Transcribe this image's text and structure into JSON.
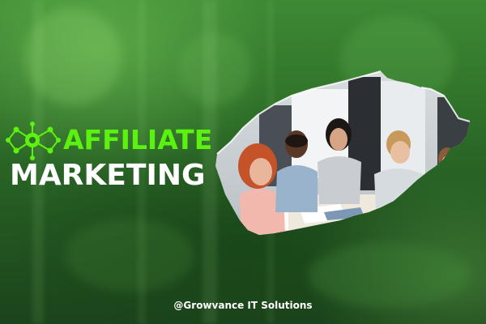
{
  "banner": {
    "title_line1": "AFFILIATE",
    "title_line2": "MARKETING",
    "credit": "@Growvance IT Solutions"
  },
  "logo": {
    "icon": "network-share-icon",
    "color": "#5cf20f"
  },
  "photo": {
    "subject": "team-meeting-photo"
  },
  "colors": {
    "accent": "#5cf20f",
    "background": "#2f7029",
    "text": "#ffffff"
  }
}
